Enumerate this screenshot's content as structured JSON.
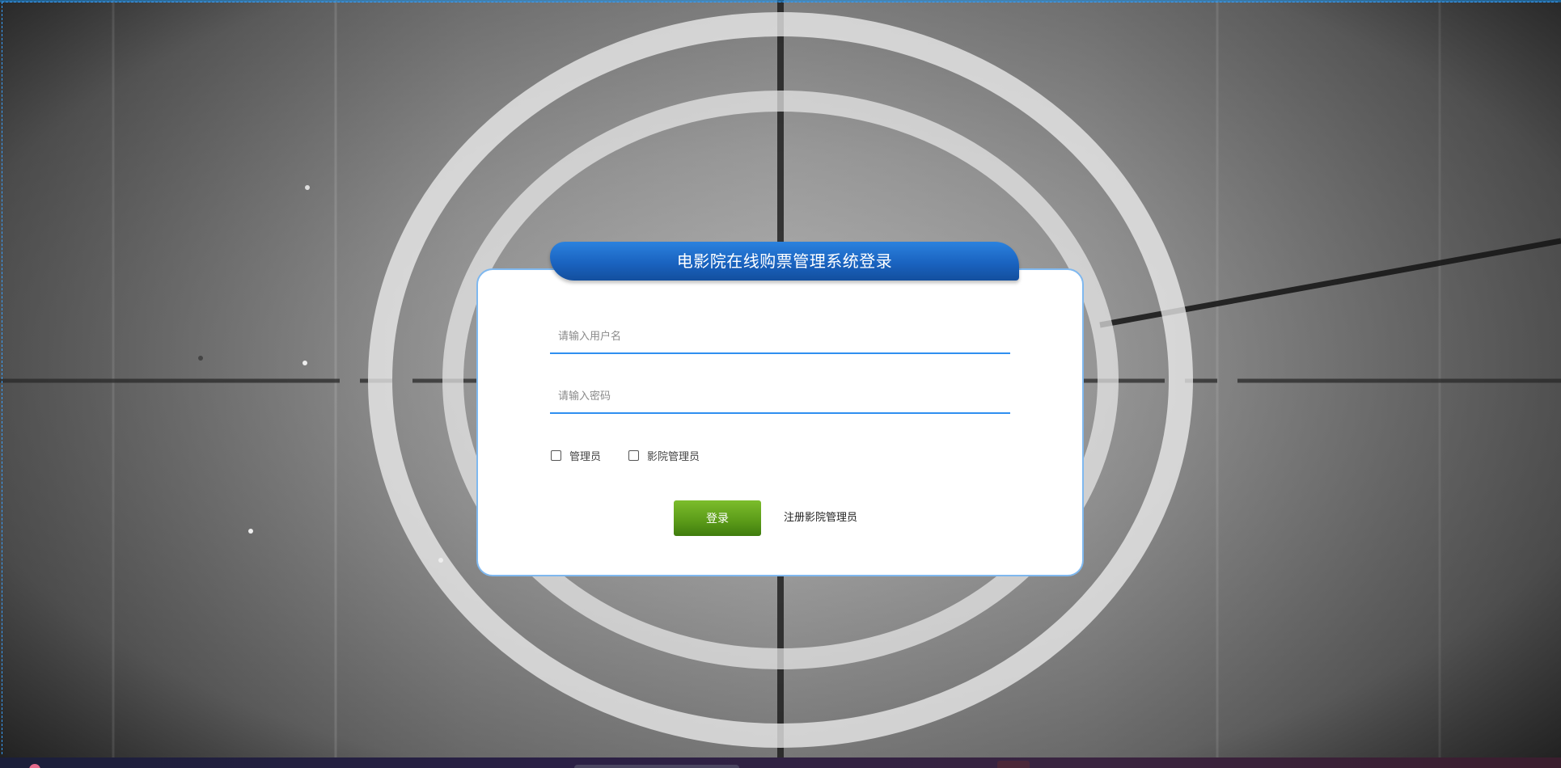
{
  "login": {
    "title": "电影院在线购票管理系统登录",
    "username_placeholder": "请输入用户名",
    "password_placeholder": "请输入密码",
    "role_admin_label": "管理员",
    "role_cinema_admin_label": "影院管理员",
    "login_button": "登录",
    "register_link": "注册影院管理员"
  },
  "colors": {
    "title_bar": "#1a63c0",
    "field_underline": "#2f8ff0",
    "login_button": "#5a9a18",
    "card_border": "#7fb8ef"
  },
  "background": {
    "description_icon": "film-countdown-leader-icon"
  }
}
